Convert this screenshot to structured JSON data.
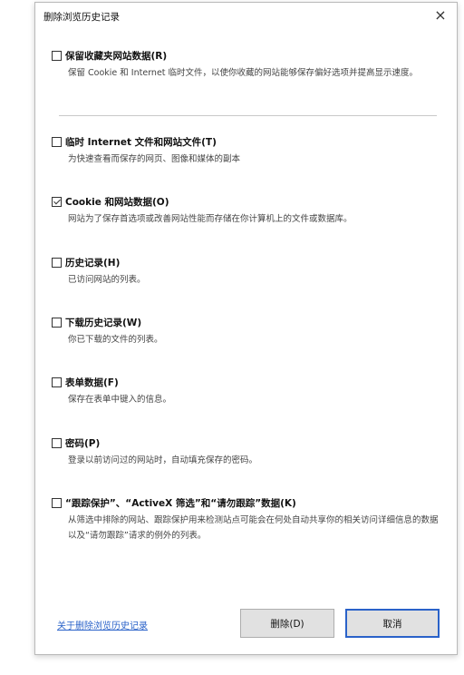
{
  "dialog": {
    "title": "删除浏览历史记录",
    "close_glyph": "×"
  },
  "options": [
    {
      "label": "保留收藏夹网站数据(R)",
      "checked": false,
      "description": "保留 Cookie 和 Internet 临时文件，以使你收藏的网站能够保存偏好选项并提高显示速度。"
    },
    {
      "label": "临时 Internet 文件和网站文件(T)",
      "checked": false,
      "description": "为快速查看而保存的网页、图像和媒体的副本"
    },
    {
      "label": "Cookie 和网站数据(O)",
      "checked": true,
      "description": "网站为了保存首选项或改善网站性能而存储在你计算机上的文件或数据库。"
    },
    {
      "label": "历史记录(H)",
      "checked": false,
      "description": "已访问网站的列表。"
    },
    {
      "label": "下载历史记录(W)",
      "checked": false,
      "description": "你已下载的文件的列表。"
    },
    {
      "label": "表单数据(F)",
      "checked": false,
      "description": "保存在表单中键入的信息。"
    },
    {
      "label": "密码(P)",
      "checked": false,
      "description": "登录以前访问过的网站时，自动填充保存的密码。"
    },
    {
      "label": "“跟踪保护”、“ActiveX 筛选”和“请勿跟踪”数据(K)",
      "checked": false,
      "description": "从筛选中排除的网站、跟踪保护用来检测站点可能会在何处自动共享你的相关访问详细信息的数据以及“请勿跟踪”请求的例外的列表。"
    }
  ],
  "footer": {
    "link": "关于删除浏览历史记录",
    "delete_button": "删除(D)",
    "cancel_button": "取消"
  }
}
